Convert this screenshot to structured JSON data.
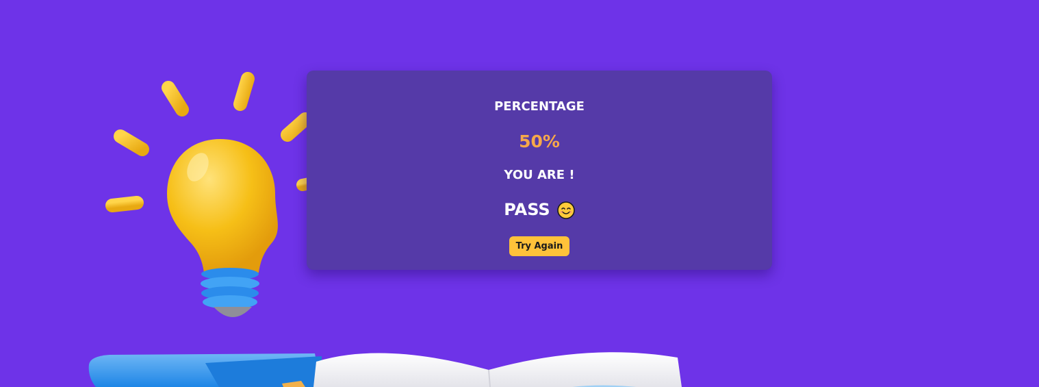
{
  "colors": {
    "background": "#6E33E8",
    "card": "#553AA8",
    "accent": "#F7A84A",
    "button": "#FFC23A",
    "text": "#FFFFFF"
  },
  "result": {
    "heading": "PERCENTAGE",
    "percentage": "50%",
    "label": "YOU ARE !",
    "verdict": "PASS",
    "verdict_icon": "smiling-face-icon"
  },
  "actions": {
    "try_again": "Try Again"
  },
  "illustration": {
    "items": [
      "lightbulb-icon",
      "open-book-icon"
    ]
  }
}
